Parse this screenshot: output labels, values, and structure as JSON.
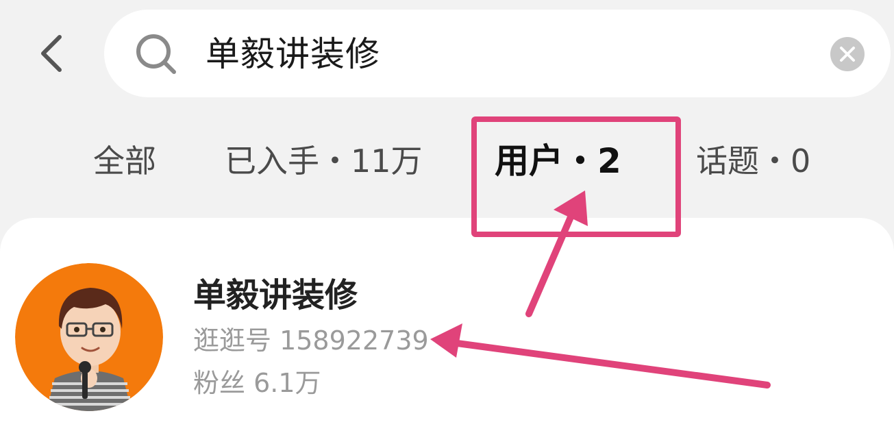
{
  "search": {
    "query": "单毅讲装修"
  },
  "tabs": [
    {
      "label": "全部",
      "active": false
    },
    {
      "label": "已入手・11万",
      "active": false
    },
    {
      "label": "用户・2",
      "active": true
    },
    {
      "label": "话题・0",
      "active": false
    }
  ],
  "result": {
    "name": "单毅讲装修",
    "id_line": "逛逛号 158922739",
    "fans_line": "粉丝 6.1万"
  },
  "icons": {
    "back": "chevron-left-icon",
    "search": "search-icon",
    "clear": "clear-icon"
  },
  "colors": {
    "background": "#f2f2f2",
    "annotation": "#e0437a",
    "avatar_bg": "#f47a0c"
  }
}
